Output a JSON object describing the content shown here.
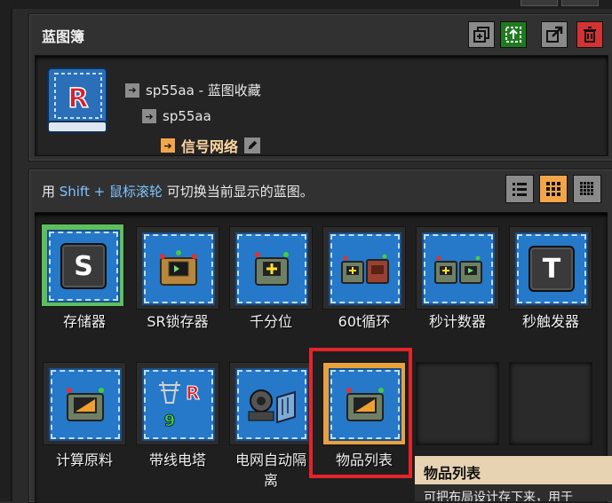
{
  "blueprint_book": {
    "title": "蓝图簿",
    "buttons": [
      "copy-icon",
      "select-area-icon",
      "export-icon",
      "trash-icon"
    ],
    "breadcrumbs": [
      {
        "label": "sp55aa - 蓝图收藏"
      },
      {
        "label": "sp55aa"
      },
      {
        "label": "信号网络"
      }
    ]
  },
  "hint": {
    "prefix": "用 ",
    "key": "Shift + 鼠标滚轮",
    "suffix": " 可切换当前显示的蓝图。"
  },
  "view_modes": [
    "list-view-icon",
    "grid-view-icon",
    "small-grid-view-icon"
  ],
  "blueprints": [
    {
      "label": "存储器",
      "icon": "letter-s-icon",
      "letter": "S"
    },
    {
      "label": "SR锁存器",
      "icon": "programmable-speaker-icon"
    },
    {
      "label": "千分位",
      "icon": "arithmetic-combinator-icon"
    },
    {
      "label": "60t循环",
      "icon": "combinator-pair-icon"
    },
    {
      "label": "秒计数器",
      "icon": "combinator-pair-icon"
    },
    {
      "label": "秒触发器",
      "icon": "letter-t-icon",
      "letter": "T"
    },
    {
      "label": "计算原料",
      "icon": "display-panel-icon"
    },
    {
      "label": "带线电塔",
      "icon": "power-pole-icon"
    },
    {
      "label": "电网自动隔",
      "label2": "离",
      "icon": "power-switch-icon"
    },
    {
      "label": "物品列表",
      "icon": "display-panel-icon"
    }
  ],
  "tooltip": {
    "title": "物品列表",
    "body": "可把布局设计存下来，用于"
  },
  "colors": {
    "selected_green": "#5dbf5d",
    "selected_orange": "#e9a13d",
    "highlight_red": "#e3242b",
    "blueprint_blue": "#2678c8",
    "hint_key": "#7fc4ff"
  }
}
